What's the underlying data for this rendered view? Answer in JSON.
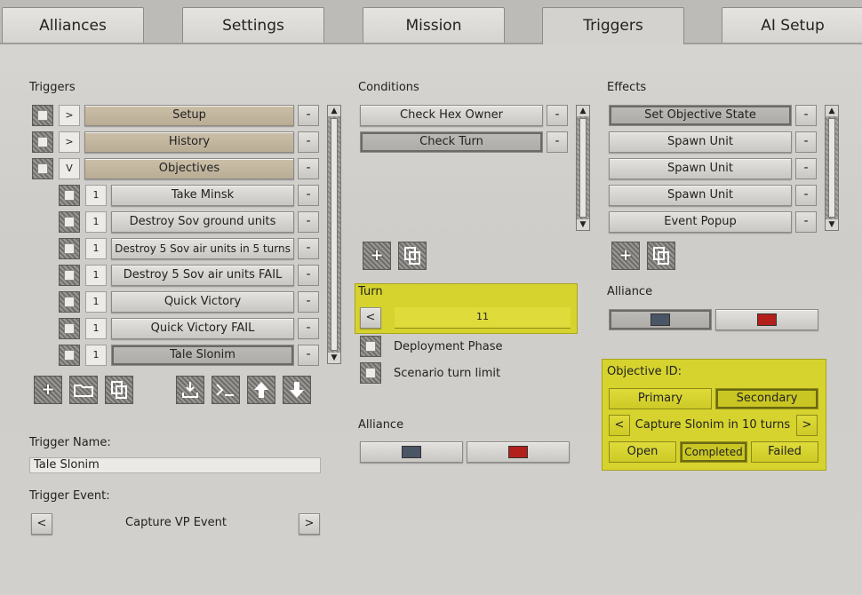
{
  "tabs": [
    "Alliances",
    "Settings",
    "Mission",
    "Triggers",
    "AI Setup"
  ],
  "active_tab": "Triggers",
  "triggers": {
    "header": "Triggers",
    "groups": [
      {
        "toggle": ">",
        "label": "Setup"
      },
      {
        "toggle": ">",
        "label": "History"
      },
      {
        "toggle": "V",
        "label": "Objectives"
      }
    ],
    "items": [
      {
        "num": "1",
        "label": "Take Minsk"
      },
      {
        "num": "1",
        "label": "Destroy Sov ground units"
      },
      {
        "num": "1",
        "label": "Destroy 5 Sov air units in 5 turns"
      },
      {
        "num": "1",
        "label": "Destroy 5 Sov air units FAIL"
      },
      {
        "num": "1",
        "label": "Quick Victory"
      },
      {
        "num": "1",
        "label": "Quick Victory FAIL"
      },
      {
        "num": "1",
        "label": "Tale Slonim"
      }
    ],
    "minus": "-"
  },
  "trigger_name": {
    "label": "Trigger Name:",
    "value": "Tale Slonim"
  },
  "trigger_event": {
    "label": "Trigger Event:",
    "value": "Capture VP Event",
    "prev": "<",
    "next": ">"
  },
  "conditions": {
    "header": "Conditions",
    "items": [
      "Check Hex Owner",
      "Check Turn"
    ]
  },
  "turn": {
    "label": "Turn",
    "prev": "<",
    "value": "11"
  },
  "checkboxes": [
    "Deployment Phase",
    "Scenario turn limit"
  ],
  "alliance_left": {
    "label": "Alliance",
    "colors": [
      "#4a5566",
      "#b3201c"
    ]
  },
  "effects": {
    "header": "Effects",
    "items": [
      "Set Objective State",
      "Spawn Unit",
      "Spawn Unit",
      "Spawn Unit",
      "Event Popup"
    ]
  },
  "alliance_right": {
    "label": "Alliance",
    "colors": [
      "#4a5566",
      "#b3201c"
    ]
  },
  "objective": {
    "label": "Objective ID:",
    "types": [
      "Primary",
      "Secondary"
    ],
    "selected_type": "Secondary",
    "prev": "<",
    "value": "Capture Slonim in 10 turns",
    "next": ">",
    "states": [
      "Open",
      "Completed",
      "Failed"
    ],
    "selected_state": "Completed"
  },
  "icons": {
    "add": "+",
    "scroll_up": "▲",
    "scroll_down": "▼"
  }
}
